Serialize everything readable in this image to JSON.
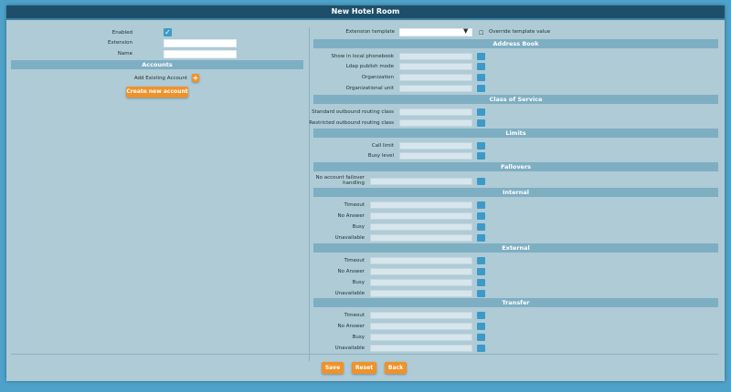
{
  "title": "New Hotel Room",
  "left": {
    "enabled_label": "Enabled",
    "extension_label": "Extension",
    "name_label": "Name",
    "accounts_header": "Accounts",
    "add_existing_label": "Add Existing Account",
    "create_button": "Create new account"
  },
  "right": {
    "template_label": "Extension template",
    "override_label": "Override template value",
    "sections": {
      "address_book": "Address Book",
      "class_of_service": "Class of Service",
      "limits": "Limits",
      "fallovers": "Fallovers",
      "internal": "Internal",
      "external": "External",
      "transfer": "Transfer"
    },
    "address_book": [
      "Show in local phonebook",
      "Ldap publish mode",
      "Organization",
      "Organizational unit"
    ],
    "class_of_service": [
      "Standard outbound routing class",
      "Restricted outbound routing class"
    ],
    "limits": [
      "Call limit",
      "Busy level"
    ],
    "fallovers": [
      "No account failover",
      "handling"
    ],
    "internal": [
      "Timeout",
      "No Answer",
      "Busy",
      "Unavailable"
    ],
    "external": [
      "Timeout",
      "No Answer",
      "Busy",
      "Unavailable"
    ],
    "transfer": [
      "Timeout",
      "No Answer",
      "Busy",
      "Unavailable"
    ]
  },
  "buttons": {
    "save": "Save",
    "reset": "Reset",
    "back": "Back"
  },
  "colors": {
    "accent": "#f0922a",
    "help": "#3d9ac8",
    "title_bar": "#1e4f6a",
    "section": "#7eaec2"
  }
}
